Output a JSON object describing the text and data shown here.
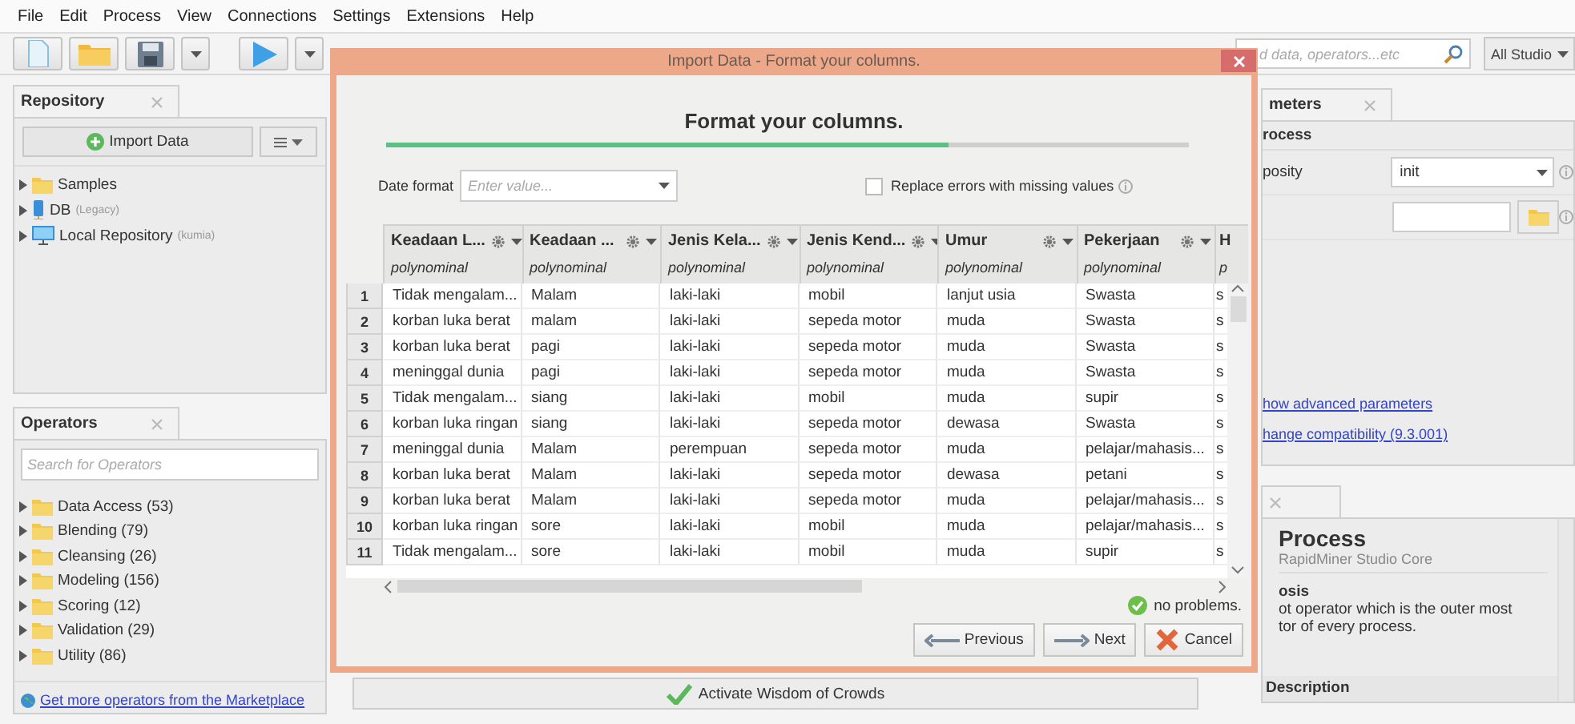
{
  "menu": [
    "File",
    "Edit",
    "Process",
    "View",
    "Connections",
    "Settings",
    "Extensions",
    "Help"
  ],
  "search": {
    "placeholder": "d data, operators...etc"
  },
  "studio_dropdown": "All Studio",
  "repository": {
    "tab": "Repository",
    "import_button": "Import Data",
    "items": [
      {
        "kind": "folder",
        "label": "Samples"
      },
      {
        "kind": "database",
        "label": "DB",
        "note": "(Legacy)"
      },
      {
        "kind": "computer",
        "label": "Local Repository",
        "note": "(kumia)"
      }
    ]
  },
  "operators": {
    "tab": "Operators",
    "search_placeholder": "Search for Operators",
    "items": [
      "Data Access (53)",
      "Blending (79)",
      "Cleansing (26)",
      "Modeling (156)",
      "Scoring (12)",
      "Validation (29)",
      "Utility (86)"
    ],
    "marketplace_link": "Get more operators from the Marketplace"
  },
  "wisdom_button": "Activate Wisdom of Crowds",
  "parameters": {
    "tab": "meters",
    "section": "rocess",
    "rows": [
      {
        "kind": "select",
        "label": "posity",
        "value": "init"
      },
      {
        "kind": "file"
      }
    ],
    "links": [
      "how advanced parameters",
      "hange compatibility (9.3.001)"
    ]
  },
  "help": {
    "title": "Process",
    "subtitle": "RapidMiner Studio Core",
    "heading": "osis",
    "lines": [
      "ot operator which is the outer most",
      "tor of every process."
    ],
    "section": "Description"
  },
  "dialog": {
    "title": "Import Data - Format your columns.",
    "heading": "Format your columns.",
    "progress": {
      "level": 0.7
    },
    "date_format": {
      "label": "Date format",
      "placeholder": "Enter value..."
    },
    "replace_errors": {
      "label": "Replace errors with missing values",
      "checked": false
    },
    "columns": [
      {
        "name": "Keadaan L...",
        "type": "polynominal"
      },
      {
        "name": "Keadaan ...",
        "type": "polynominal"
      },
      {
        "name": "Jenis Kela...",
        "type": "polynominal"
      },
      {
        "name": "Jenis Kend...",
        "type": "polynominal"
      },
      {
        "name": "Umur",
        "type": "polynominal"
      },
      {
        "name": "Pekerjaan",
        "type": "polynominal"
      },
      {
        "name": "H",
        "type": "p"
      }
    ],
    "rows": [
      {
        "number": "1",
        "cells": [
          "Tidak mengalam...",
          "Malam",
          "laki-laki",
          "mobil",
          "lanjut usia",
          "Swasta",
          "s"
        ]
      },
      {
        "number": "2",
        "cells": [
          "korban luka berat",
          "malam",
          "laki-laki",
          "sepeda motor",
          "muda",
          "Swasta",
          "s"
        ]
      },
      {
        "number": "3",
        "cells": [
          "korban luka berat",
          "pagi",
          "laki-laki",
          "sepeda motor",
          "muda",
          "Swasta",
          "s"
        ]
      },
      {
        "number": "4",
        "cells": [
          "meninggal dunia",
          "pagi",
          "laki-laki",
          "sepeda motor",
          "muda",
          "Swasta",
          "s"
        ]
      },
      {
        "number": "5",
        "cells": [
          "Tidak mengalam...",
          "siang",
          "laki-laki",
          "mobil",
          "muda",
          "supir",
          "s"
        ]
      },
      {
        "number": "6",
        "cells": [
          "korban luka ringan",
          "siang",
          "laki-laki",
          "sepeda motor",
          "dewasa",
          "Swasta",
          "s"
        ]
      },
      {
        "number": "7",
        "cells": [
          "meninggal dunia",
          "Malam",
          "perempuan",
          "sepeda motor",
          "muda",
          "pelajar/mahasis...",
          "s"
        ]
      },
      {
        "number": "8",
        "cells": [
          "korban luka berat",
          "Malam",
          "laki-laki",
          "sepeda motor",
          "dewasa",
          "petani",
          "s"
        ]
      },
      {
        "number": "9",
        "cells": [
          "korban luka berat",
          "Malam",
          "laki-laki",
          "sepeda motor",
          "muda",
          "pelajar/mahasis...",
          "s"
        ]
      },
      {
        "number": "10",
        "cells": [
          "korban luka ringan",
          "sore",
          "laki-laki",
          "mobil",
          "muda",
          "pelajar/mahasis...",
          "s"
        ]
      },
      {
        "number": "11",
        "cells": [
          "Tidak mengalam...",
          "sore",
          "laki-laki",
          "mobil",
          "muda",
          "supir",
          "s"
        ]
      }
    ],
    "status": "no problems.",
    "buttons": [
      {
        "kind": "previous",
        "label": "Previous"
      },
      {
        "kind": "next",
        "label": "Next"
      },
      {
        "kind": "cancel",
        "label": "Cancel"
      }
    ]
  }
}
